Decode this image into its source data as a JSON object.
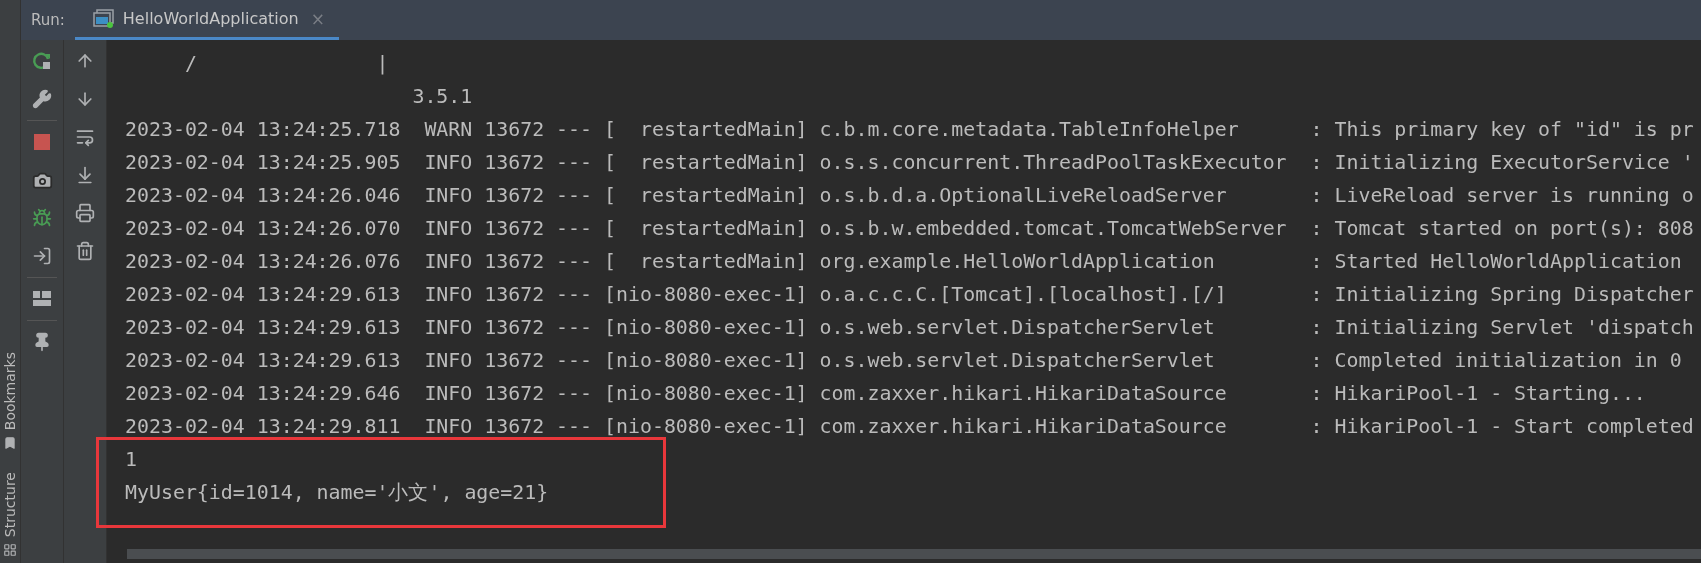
{
  "sidebar": {
    "items": [
      {
        "label": "Bookmarks",
        "kind": "bookmarks"
      },
      {
        "label": "Structure",
        "kind": "structure"
      }
    ]
  },
  "run_panel": {
    "label": "Run:",
    "tabs": [
      {
        "title": "HelloWorldApplication",
        "selected": true,
        "close": "×"
      }
    ]
  },
  "console": {
    "lines": [
      "     /               |",
      "                        3.5.1",
      "2023-02-04 13:24:25.718  WARN 13672 --- [  restartedMain] c.b.m.core.metadata.TableInfoHelper      : This primary key of \"id\" is pr",
      "2023-02-04 13:24:25.905  INFO 13672 --- [  restartedMain] o.s.s.concurrent.ThreadPoolTaskExecutor  : Initializing ExecutorService '",
      "2023-02-04 13:24:26.046  INFO 13672 --- [  restartedMain] o.s.b.d.a.OptionalLiveReloadServer       : LiveReload server is running o",
      "2023-02-04 13:24:26.070  INFO 13672 --- [  restartedMain] o.s.b.w.embedded.tomcat.TomcatWebServer  : Tomcat started on port(s): 808",
      "2023-02-04 13:24:26.076  INFO 13672 --- [  restartedMain] org.example.HelloWorldApplication        : Started HelloWorldApplication",
      "2023-02-04 13:24:29.613  INFO 13672 --- [nio-8080-exec-1] o.a.c.c.C.[Tomcat].[localhost].[/]       : Initializing Spring Dispatcher",
      "2023-02-04 13:24:29.613  INFO 13672 --- [nio-8080-exec-1] o.s.web.servlet.DispatcherServlet        : Initializing Servlet 'dispatch",
      "2023-02-04 13:24:29.613  INFO 13672 --- [nio-8080-exec-1] o.s.web.servlet.DispatcherServlet        : Completed initialization in 0",
      "2023-02-04 13:24:29.646  INFO 13672 --- [nio-8080-exec-1] com.zaxxer.hikari.HikariDataSource       : HikariPool-1 - Starting...",
      "2023-02-04 13:24:29.811  INFO 13672 --- [nio-8080-exec-1] com.zaxxer.hikari.HikariDataSource       : HikariPool-1 - Start completed"
    ],
    "output": [
      "1",
      "MyUser{id=1014, name='小文', age=21}"
    ]
  }
}
